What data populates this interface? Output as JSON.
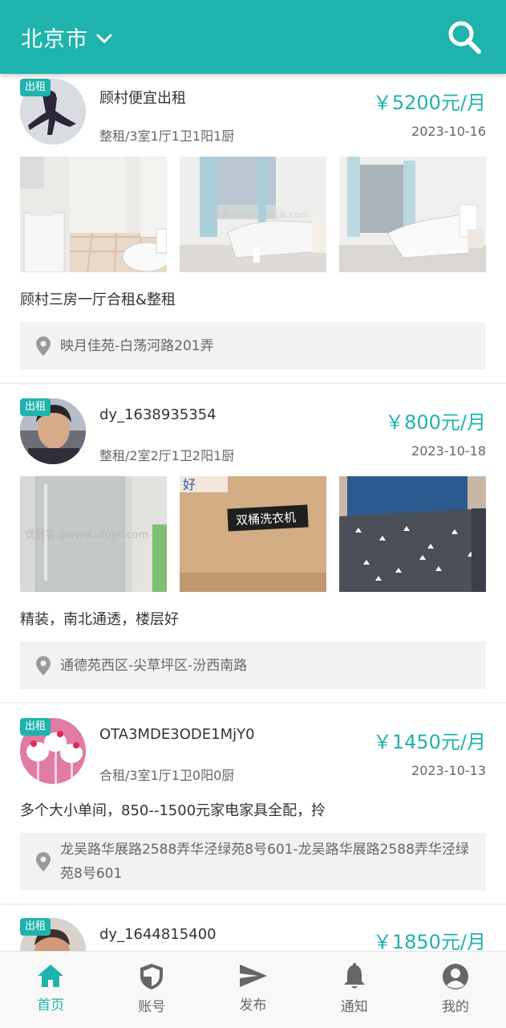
{
  "header": {
    "city": "北京市"
  },
  "listings": [
    {
      "badge": "出租",
      "user": "顾村便宜出租",
      "price": "￥5200元/月",
      "spec": "整租/3室1厅1卫1阳1厨",
      "date": "2023-10-16",
      "photos": [
        "bathroom-photo",
        "bedroom-photo",
        "bedroom-photo"
      ],
      "watermark": "优居客@www.ufojjk.com",
      "description": "顾村三房一厅合租&整租",
      "address": "映月佳苑-白荡河路201弄"
    },
    {
      "badge": "出租",
      "user": "dy_1638935354",
      "price": "￥800元/月",
      "spec": "整租/2室2厅1卫2阳1厨",
      "date": "2023-10-18",
      "photos": [
        "fridge-photo",
        "washing-machine-box-photo",
        "bed-photo"
      ],
      "watermark": "优居客@www.ufojjk.com",
      "box_label": "双桶洗衣机",
      "description": "精装，南北通透，楼层好",
      "address": "通德苑西区-尖草坪区-汾西南路"
    },
    {
      "badge": "出租",
      "user": "OTA3MDE3ODE1MjY0",
      "price": "￥1450元/月",
      "spec": "合租/3室1厅1卫0阳0厨",
      "date": "2023-10-13",
      "description": "多个大小单间，850--1500元家电家具全配，拎",
      "address": "龙吴路华展路2588弄华泾绿苑8号601-龙吴路华展路2588弄华泾绿苑8号601"
    },
    {
      "badge": "出租",
      "user": "dy_1644815400",
      "price": "￥1850元/月"
    }
  ],
  "tabbar": [
    {
      "label": "首页",
      "icon": "home-icon",
      "active": true
    },
    {
      "label": "账号",
      "icon": "shield-icon",
      "active": false
    },
    {
      "label": "发布",
      "icon": "send-icon",
      "active": false
    },
    {
      "label": "通知",
      "icon": "bell-icon",
      "active": false
    },
    {
      "label": "我的",
      "icon": "user-icon",
      "active": false
    }
  ],
  "colors": {
    "accent": "#1fb3ad",
    "text": "#333333",
    "muted": "#666666",
    "panel": "#f2f2f2"
  }
}
